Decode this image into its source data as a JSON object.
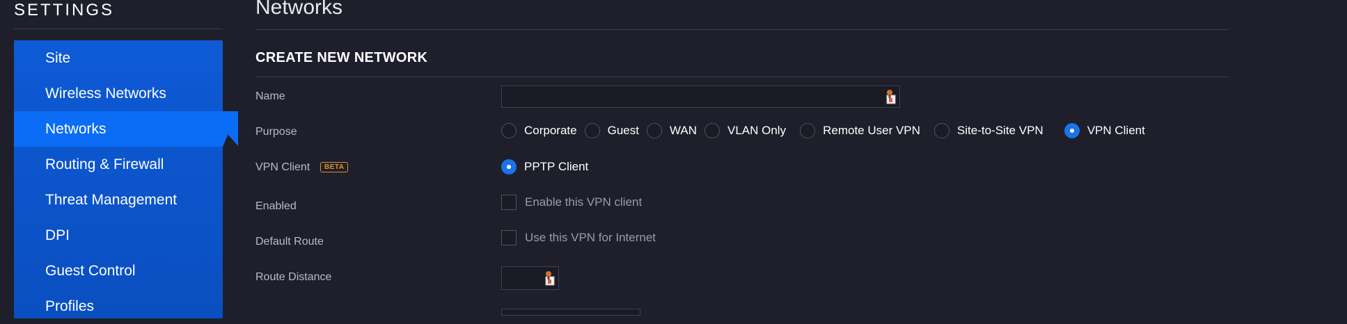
{
  "sidebar": {
    "title": "SETTINGS",
    "items": [
      {
        "label": "Site",
        "active": false
      },
      {
        "label": "Wireless Networks",
        "active": false
      },
      {
        "label": "Networks",
        "active": true
      },
      {
        "label": "Routing & Firewall",
        "active": false
      },
      {
        "label": "Threat Management",
        "active": false
      },
      {
        "label": "DPI",
        "active": false
      },
      {
        "label": "Guest Control",
        "active": false
      },
      {
        "label": "Profiles",
        "active": false
      }
    ]
  },
  "header": {
    "title": "Networks"
  },
  "form": {
    "section_title": "CREATE NEW NETWORK",
    "name": {
      "label": "Name",
      "value": "",
      "placeholder": ""
    },
    "purpose": {
      "label": "Purpose",
      "options": [
        {
          "label": "Corporate",
          "selected": false
        },
        {
          "label": "Guest",
          "selected": false
        },
        {
          "label": "WAN",
          "selected": false
        },
        {
          "label": "VLAN Only",
          "selected": false
        },
        {
          "label": "Remote User VPN",
          "selected": false
        },
        {
          "label": "Site-to-Site VPN",
          "selected": false
        },
        {
          "label": "VPN Client",
          "selected": true
        }
      ]
    },
    "vpn_client": {
      "label": "VPN Client",
      "badge": "BETA",
      "options": [
        {
          "label": "PPTP Client",
          "selected": true
        }
      ]
    },
    "enabled": {
      "label": "Enabled",
      "checkbox_label": "Enable this VPN client",
      "checked": false
    },
    "default_route": {
      "label": "Default Route",
      "checkbox_label": "Use this VPN for Internet",
      "checked": false
    },
    "route_distance": {
      "label": "Route Distance",
      "value": ""
    }
  },
  "colors": {
    "background": "#1e1f2b",
    "sidebar": "#0a4fc0",
    "sidebar_active": "#0b6cf5",
    "accent": "#1a73e8",
    "beta": "#e0912f"
  },
  "icons": {
    "autofill": "password-manager-icon"
  }
}
